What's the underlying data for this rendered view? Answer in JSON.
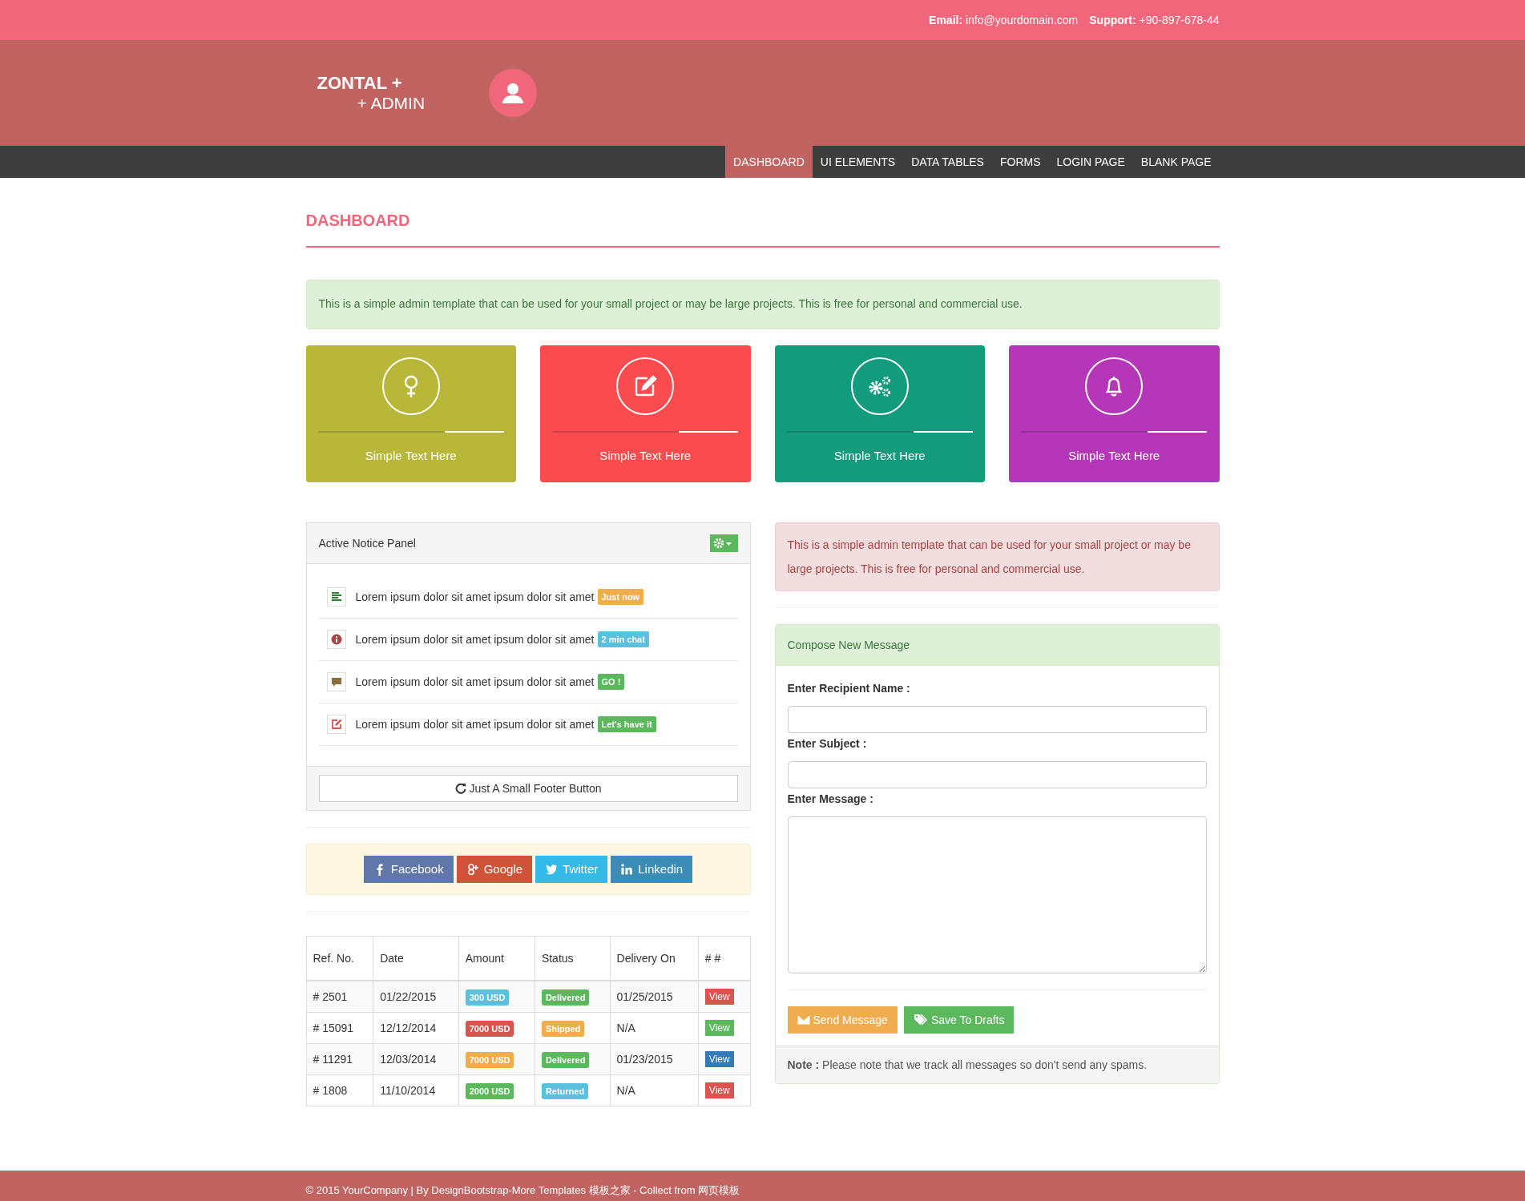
{
  "top_bar": {
    "email": "**Email:** info@yourdomain.com",
    "support": "**Support:** +90-897-678-44"
  },
  "logo": {
    "line_1": "ZONTAL +",
    "line_2": "+ ADMIN"
  },
  "nav": [
    {
      "label": "DASHBOARD",
      "selected": true
    },
    {
      "label": "UI ELEMENTS",
      "selected": false
    },
    {
      "label": "DATA TABLES",
      "selected": false
    },
    {
      "label": "FORMS",
      "selected": false
    },
    {
      "label": "LOGIN PAGE",
      "selected": false
    },
    {
      "label": "BLANK PAGE",
      "selected": false
    }
  ],
  "page_title": "DASHBOARD",
  "info_alert": "This is a simple admin template that can be used for your small project or may be large projects. This is free for personal and commercial use.",
  "cards": [
    {
      "kind": "female",
      "label": "Simple Text Here",
      "color": "#b8b73a"
    },
    {
      "kind": "edit",
      "label": "Simple Text Here",
      "color": "#fa4c4f"
    },
    {
      "kind": "gears",
      "label": "Simple Text Here",
      "color": "#139b7e"
    },
    {
      "kind": "bell",
      "label": "Simple Text Here",
      "color": "#b536b8"
    }
  ],
  "notice_panel": {
    "title": "Active Notice Panel",
    "items": [
      {
        "kind": "lines",
        "text": "Lorem ipsum dolor sit amet ipsum dolor sit amet",
        "badge": "Just now",
        "color": "#f0ad4e"
      },
      {
        "kind": "info",
        "text": "Lorem ipsum dolor sit amet ipsum dolor sit amet",
        "badge": "2 min chat",
        "color": "#5bc0de"
      },
      {
        "kind": "comment",
        "text": "Lorem ipsum dolor sit amet ipsum dolor sit amet",
        "badge": "GO !",
        "color": "#5cb85c"
      },
      {
        "kind": "edit",
        "text": "Lorem ipsum dolor sit amet ipsum dolor sit amet",
        "badge": "Let's have it",
        "color": "#5cb85c"
      }
    ],
    "footer_button": "Just A Small Footer Button"
  },
  "social_buttons": [
    {
      "kind": "facebook",
      "label": "Facebook",
      "color": "#6077a9"
    },
    {
      "kind": "google",
      "label": "Google",
      "color": "#cf5339"
    },
    {
      "kind": "twitter",
      "label": "Twitter",
      "color": "#33bae8"
    },
    {
      "kind": "linkedin",
      "label": "Linkedin",
      "color": "#3a8bb5"
    }
  ],
  "table": {
    "columns": [
      "Ref. No.",
      "Date",
      "Amount",
      "Status",
      "Delivery On",
      "# #"
    ],
    "rows": [
      {
        "ref": "# 2501",
        "date": "01/22/2015",
        "amount": {
          "text": "300 USD",
          "color": "#5bc0de"
        },
        "status": {
          "text": "Delivered",
          "color": "#5cb85c"
        },
        "delivery": "01/25/2015",
        "action": {
          "text": "View",
          "color": "#d9534f"
        }
      },
      {
        "ref": "# 15091",
        "date": "12/12/2014",
        "amount": {
          "text": "7000 USD",
          "color": "#d9534f"
        },
        "status": {
          "text": "Shipped",
          "color": "#f0ad4e"
        },
        "delivery": "N/A",
        "action": {
          "text": "View",
          "color": "#5cb85c"
        }
      },
      {
        "ref": "# 11291",
        "date": "12/03/2014",
        "amount": {
          "text": "7000 USD",
          "color": "#f0ad4e"
        },
        "status": {
          "text": "Delivered",
          "color": "#5cb85c"
        },
        "delivery": "01/23/2015",
        "action": {
          "text": "View",
          "color": "#337ab7"
        }
      },
      {
        "ref": "# 1808",
        "date": "11/10/2014",
        "amount": {
          "text": "2000 USD",
          "color": "#5cb85c"
        },
        "status": {
          "text": "Returned",
          "color": "#5bc0de"
        },
        "delivery": "N/A",
        "action": {
          "text": "View",
          "color": "#d9534f"
        }
      }
    ]
  },
  "danger_alert": "This is a simple admin template that can be used for your small project or may be large projects. This is free for personal and commercial use.",
  "compose": {
    "title": "Compose New Message",
    "fields": [
      {
        "kind": "input",
        "label": "Enter Recipient Name :"
      },
      {
        "kind": "input",
        "label": "Enter Subject :"
      },
      {
        "kind": "textarea",
        "label": "Enter Message :"
      }
    ],
    "buttons": [
      {
        "kind": "send",
        "label": "Send Message",
        "color": "#f0ad4e"
      },
      {
        "kind": "drafts",
        "label": "Save To Drafts",
        "color": "#5cb85c"
      }
    ],
    "note": "**Note :** Please note that we track all messages so don't send any spams."
  },
  "footer": "© 2015 YourCompany | By DesignBootstrap-More Templates 模板之家 - Collect from 网页模板"
}
